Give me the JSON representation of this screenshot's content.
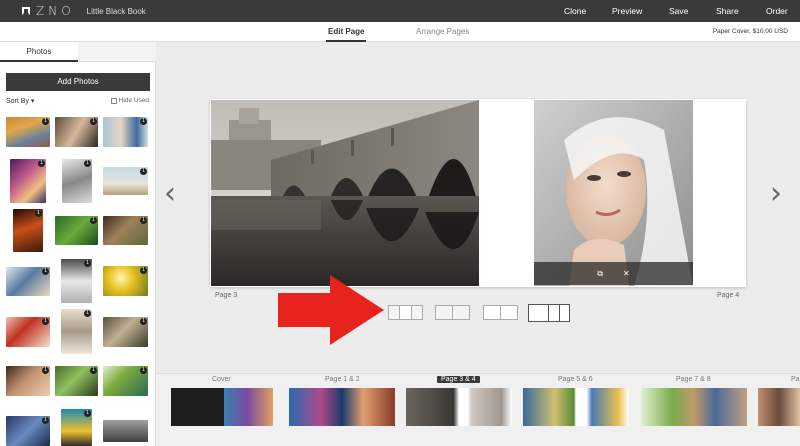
{
  "app": {
    "logo": "ZNO",
    "book_title": "Little Black Book"
  },
  "top_actions": {
    "clone": "Clone",
    "preview": "Preview",
    "save": "Save",
    "share": "Share",
    "order": "Order"
  },
  "tabs": {
    "edit": "Edit Page",
    "arrange": "Arrange Pages"
  },
  "price": "Paper Cover, $10.00 USD",
  "sidebar": {
    "tab_photos": "Photos",
    "add_photos": "Add Photos",
    "sort_by": "Sort By ▾",
    "hide_used": "Hide Used",
    "badge": "1"
  },
  "pages": {
    "left": "Page 3",
    "right": "Page 4"
  },
  "photo_tools": {
    "crop": "⧉",
    "close": "✕"
  },
  "filmstrip": {
    "labels": [
      "Cover",
      "Page 1 & 2",
      "Page 3 & 4",
      "Page 5 & 6",
      "Page 7 & 8",
      "Pa"
    ]
  },
  "colors": {
    "topbar": "#3a3a3a",
    "arrow": "#e8231d"
  }
}
